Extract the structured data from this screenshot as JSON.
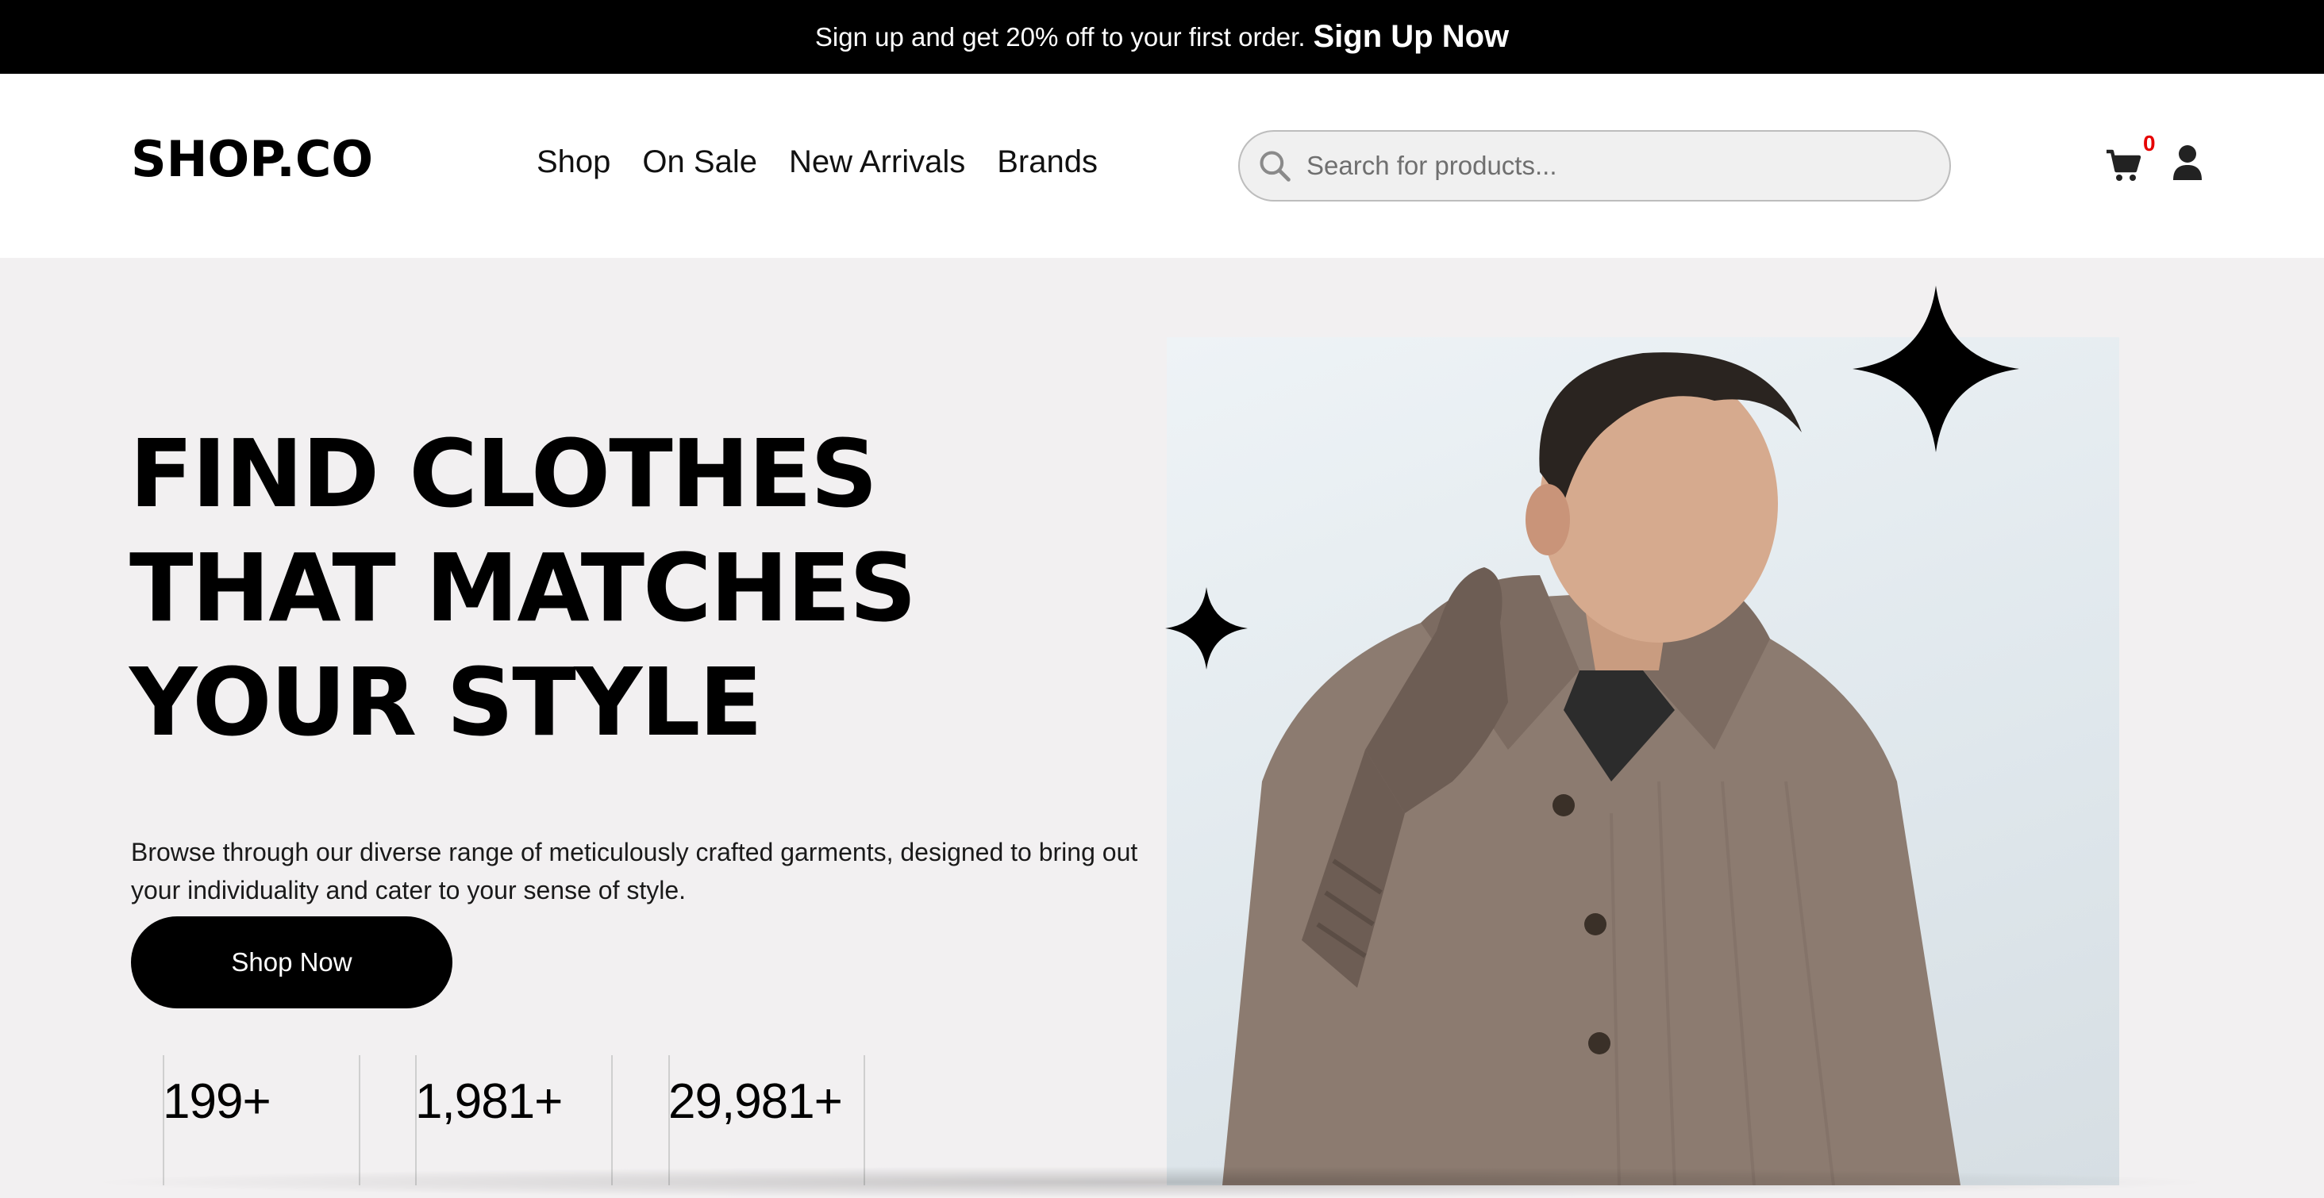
{
  "promo": {
    "text": "Sign up and get 20% off to your first order.",
    "link": "Sign Up Now"
  },
  "header": {
    "logo": "SHOP.CO",
    "nav": [
      "Shop",
      "On Sale",
      "New Arrivals",
      "Brands"
    ],
    "search_placeholder": "Search for products...",
    "cart_count": "0",
    "icons": [
      "search-icon",
      "cart-icon",
      "user-icon"
    ]
  },
  "hero": {
    "headline": [
      "FIND CLOTHES",
      "THAT MATCHES",
      "YOUR STYLE"
    ],
    "description": "Browse through our diverse range of meticulously crafted garments, designed to bring out your individuality and cater to your sense of style.",
    "cta": "Shop Now",
    "stats": [
      "199+",
      "1,981+",
      "29,981+"
    ],
    "image": "man-in-knit-sweater-and-gloves"
  },
  "colors": {
    "accent": "#000000",
    "background": "#f2f0f1",
    "badge": "#e60000"
  }
}
